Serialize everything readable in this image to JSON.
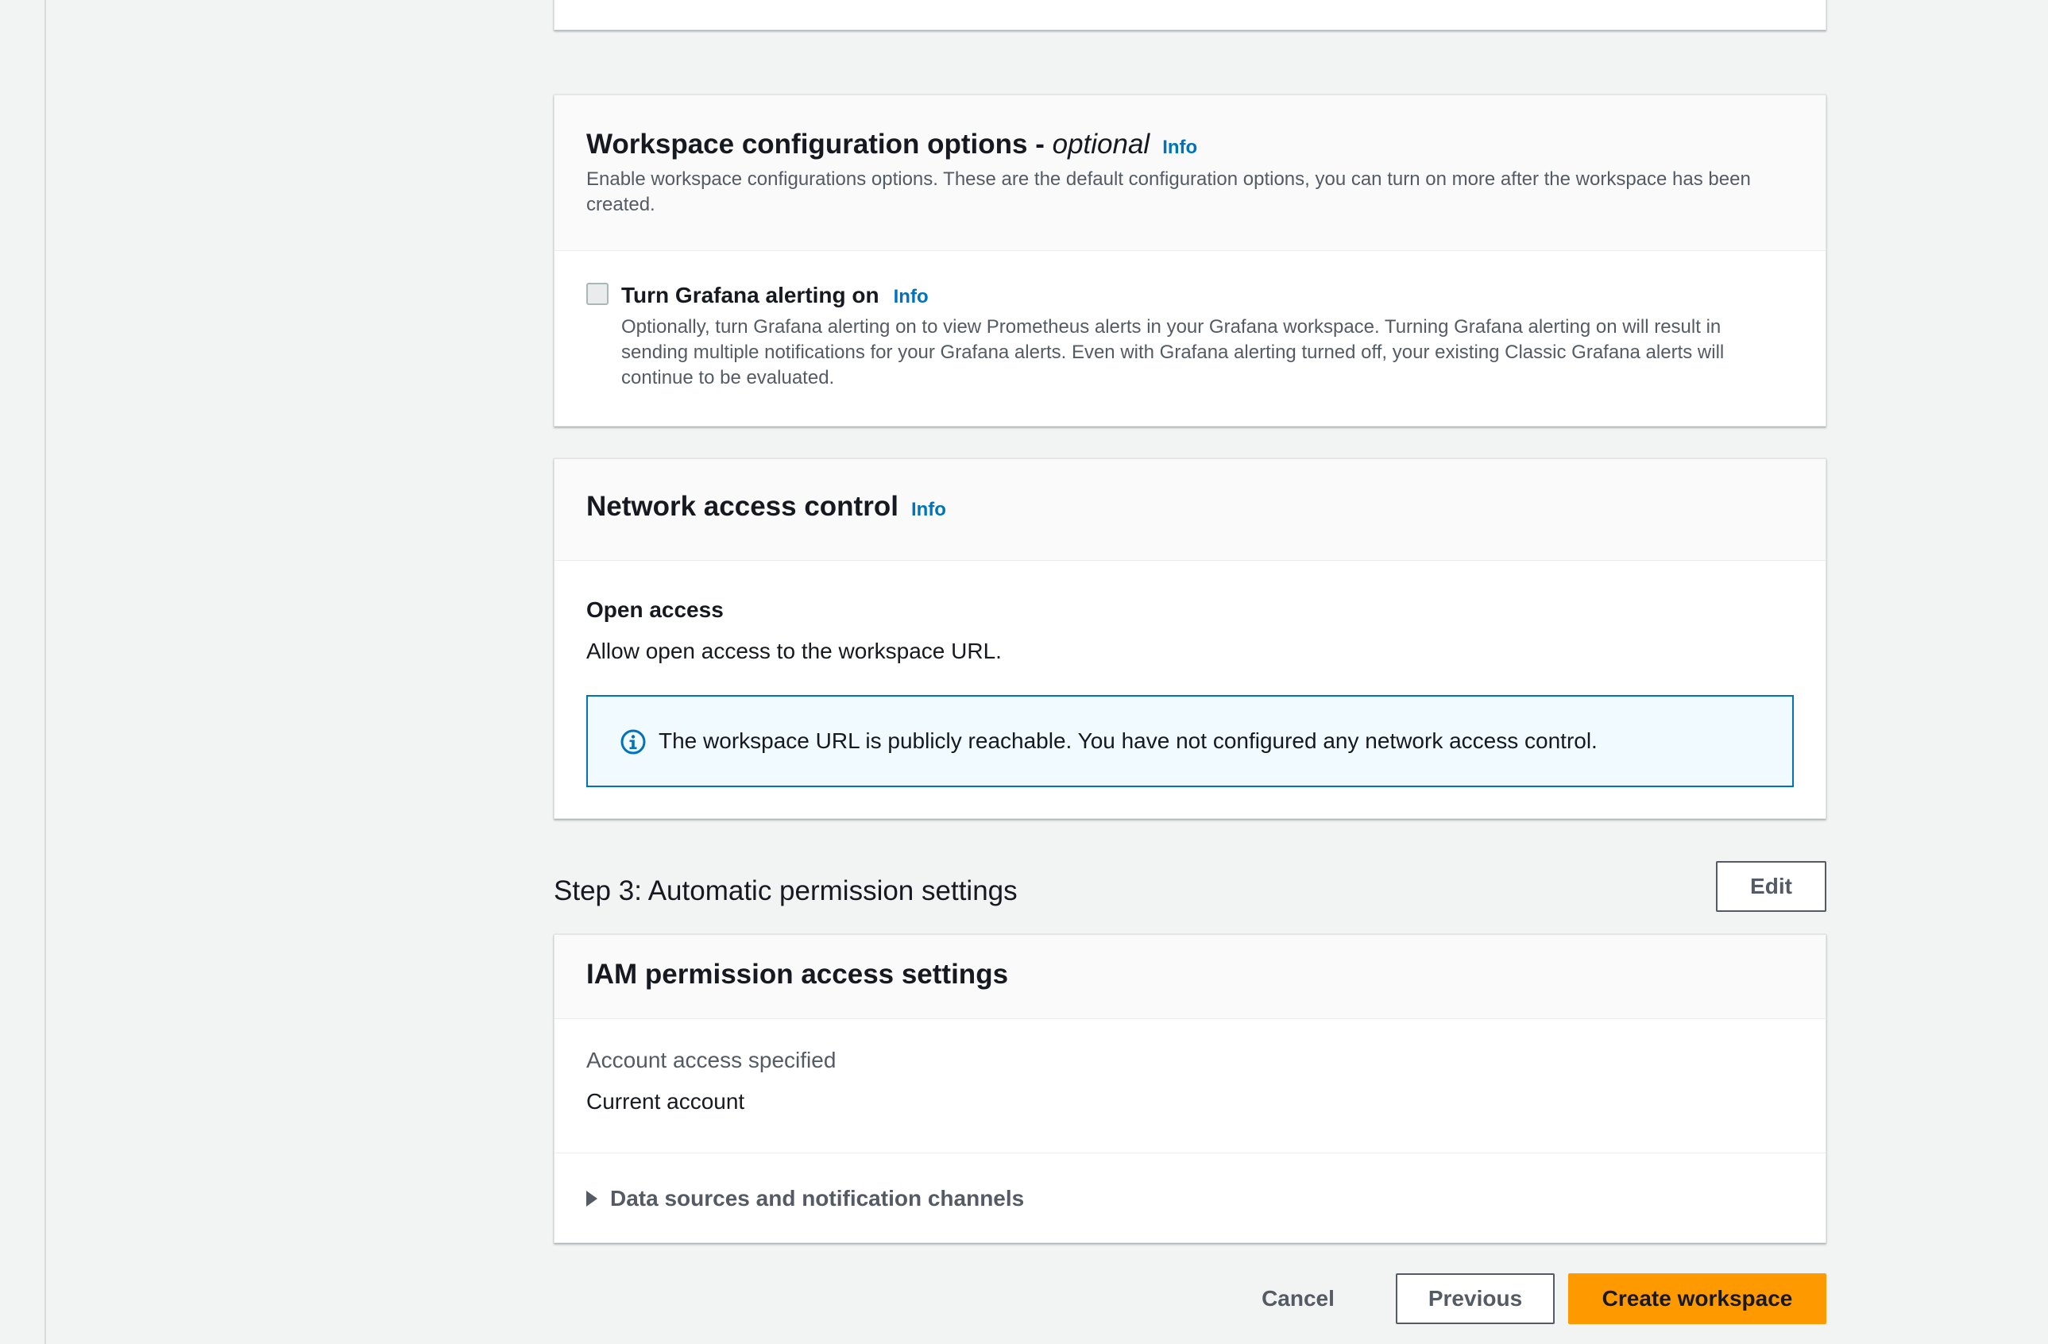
{
  "config": {
    "title": "Workspace configuration options - ",
    "title_optional": "optional",
    "info": "Info",
    "description": "Enable workspace configurations options. These are the default configuration options, you can turn on more after the workspace has been created.",
    "alerting": {
      "label": "Turn Grafana alerting on",
      "info": "Info",
      "checked": false,
      "description": "Optionally, turn Grafana alerting on to view Prometheus alerts in your Grafana workspace. Turning Grafana alerting on will result in sending multiple notifications for your Grafana alerts. Even with Grafana alerting turned off, your existing Classic Grafana alerts will continue to be evaluated."
    }
  },
  "network": {
    "title": "Network access control",
    "info": "Info",
    "open_title": "Open access",
    "open_desc": "Allow open access to the workspace URL.",
    "alert_text": "The workspace URL is publicly reachable. You have not configured any network access control."
  },
  "step3": {
    "title": "Step 3: Automatic permission settings",
    "edit_label": "Edit"
  },
  "iam": {
    "title": "IAM permission access settings",
    "account_label": "Account access specified",
    "account_value": "Current account",
    "expander_label": "Data sources and notification channels"
  },
  "footer": {
    "cancel_label": "Cancel",
    "previous_label": "Previous",
    "create_label": "Create workspace"
  },
  "colors": {
    "accent": "#0073bb",
    "primary_button": "#ff9900",
    "background": "#f2f3f3"
  }
}
